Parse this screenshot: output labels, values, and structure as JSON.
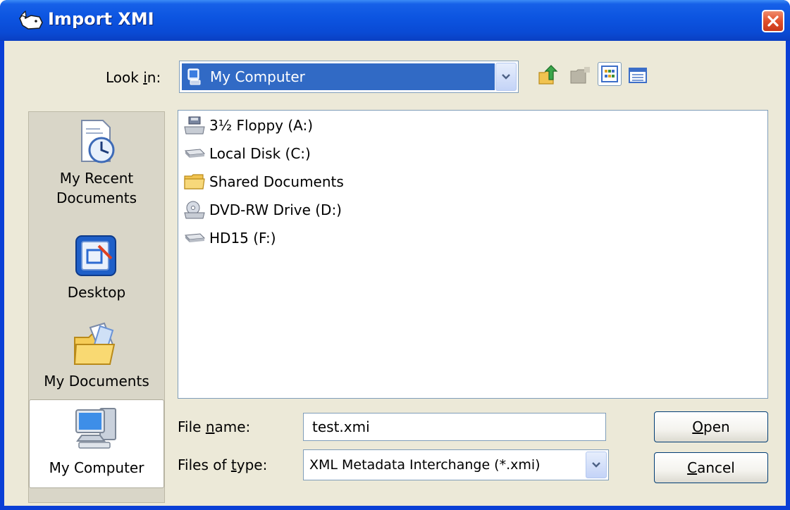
{
  "window": {
    "title": "Import XMI",
    "icon": "rhino-app-icon",
    "close_icon": "close-icon"
  },
  "lookin": {
    "label_pre": "Look ",
    "label_u": "i",
    "label_post": "n:",
    "value": "My Computer",
    "icon": "my-computer-icon"
  },
  "toolbar": {
    "icons": [
      "up-folder-icon",
      "new-folder-icon",
      "view-list-icon",
      "view-details-icon"
    ]
  },
  "places": [
    {
      "label": "My Recent",
      "label2": "Documents",
      "icon": "recent-documents-icon"
    },
    {
      "label": "Desktop",
      "icon": "desktop-icon"
    },
    {
      "label": "My Documents",
      "icon": "my-documents-icon"
    },
    {
      "label": "My Computer",
      "icon": "my-computer-icon",
      "selected": true
    }
  ],
  "files": [
    {
      "name": "3½ Floppy (A:)",
      "icon": "floppy-drive-icon"
    },
    {
      "name": "Local Disk (C:)",
      "icon": "hard-disk-icon"
    },
    {
      "name": "Shared Documents",
      "icon": "folder-icon"
    },
    {
      "name": "DVD-RW Drive (D:)",
      "icon": "dvd-drive-icon"
    },
    {
      "name": "HD15 (F:)",
      "icon": "hard-disk-icon"
    }
  ],
  "filename": {
    "label_pre": "File ",
    "label_u": "n",
    "label_post": "ame:",
    "value": "test.xmi"
  },
  "filetype": {
    "label_pre": "Files of ",
    "label_u": "t",
    "label_post": "ype:",
    "value": "XML Metadata Interchange (*.xmi)"
  },
  "buttons": {
    "open_u": "O",
    "open_rest": "pen",
    "cancel_u": "C",
    "cancel_rest": "ancel"
  },
  "colors": {
    "titlebar": "#0a4ad4",
    "dialog_bg": "#ece9d8",
    "selection": "#316ac5"
  }
}
